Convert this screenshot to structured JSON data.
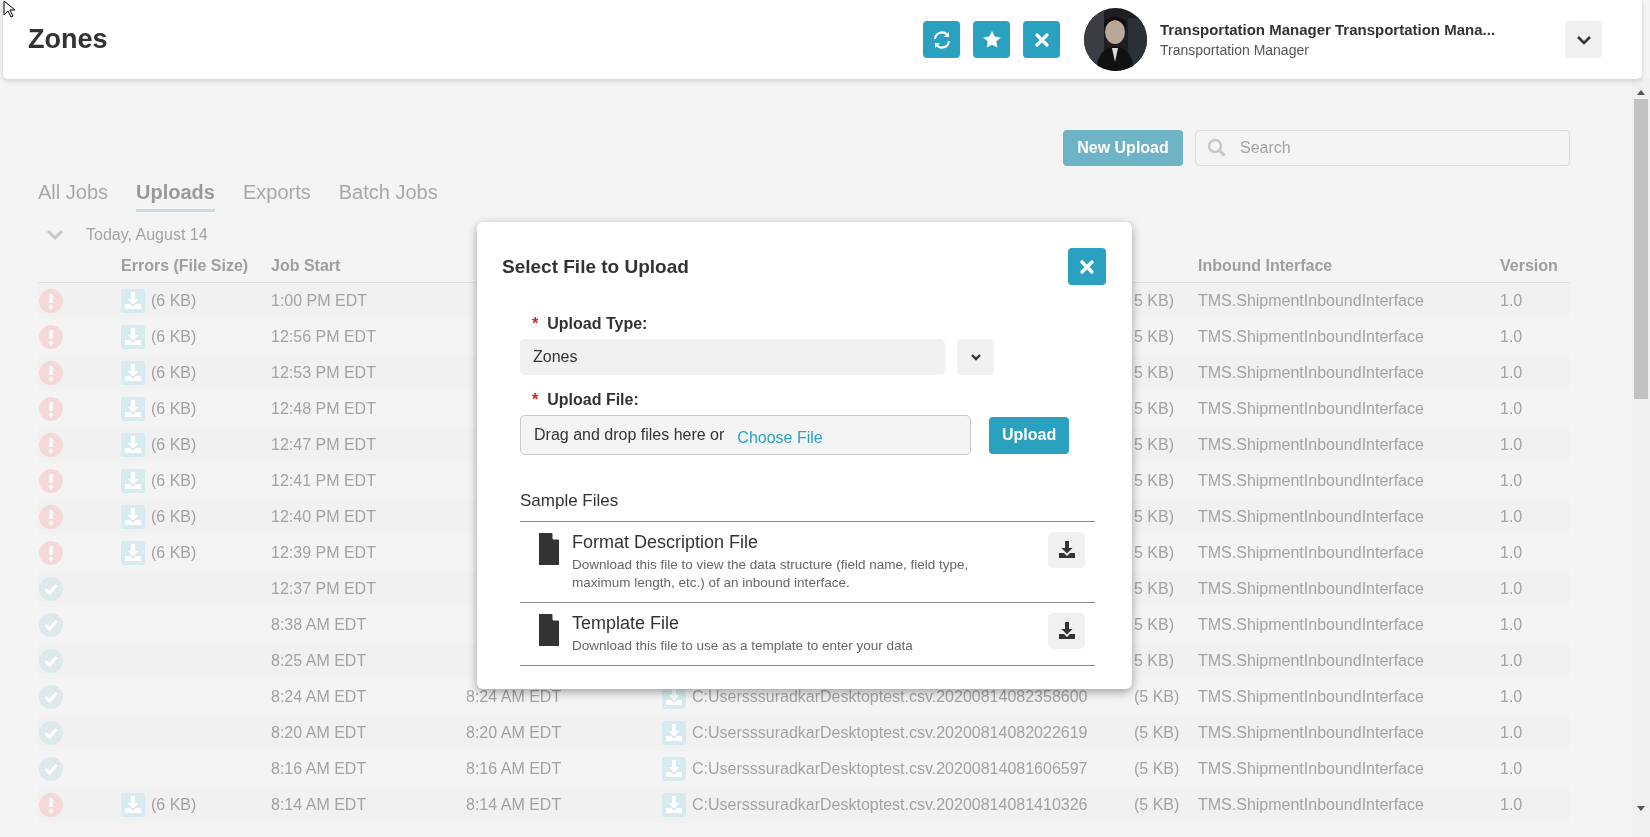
{
  "header": {
    "title": "Zones",
    "user": {
      "name": "Transportation Manager Transportation Mana...",
      "role": "Transportation Manager"
    }
  },
  "toolbar": {
    "new_upload": "New Upload",
    "search": {
      "placeholder": "Search"
    }
  },
  "tabs": [
    {
      "label": "All Jobs",
      "selected": false
    },
    {
      "label": "Uploads",
      "selected": true
    },
    {
      "label": "Exports",
      "selected": false
    },
    {
      "label": "Batch Jobs",
      "selected": false
    }
  ],
  "group": {
    "label": "Today, August 14",
    "expanded": true
  },
  "table": {
    "columns": [
      "Errors (File Size)",
      "Job Start",
      "Inbound Interface",
      "Version"
    ],
    "rows": [
      {
        "kind": "error",
        "error_size": "(6 KB)",
        "job_start": "1:00 PM EDT",
        "file_size": "5 KB)",
        "interface": "TMS.ShipmentInboundInterface",
        "version": "1.0"
      },
      {
        "kind": "error",
        "error_size": "(6 KB)",
        "job_start": "12:56 PM EDT",
        "file_size": "5 KB)",
        "interface": "TMS.ShipmentInboundInterface",
        "version": "1.0"
      },
      {
        "kind": "error",
        "error_size": "(6 KB)",
        "job_start": "12:53 PM EDT",
        "file_size": "5 KB)",
        "interface": "TMS.ShipmentInboundInterface",
        "version": "1.0"
      },
      {
        "kind": "error",
        "error_size": "(6 KB)",
        "job_start": "12:48 PM EDT",
        "file_size": "5 KB)",
        "interface": "TMS.ShipmentInboundInterface",
        "version": "1.0"
      },
      {
        "kind": "error",
        "error_size": "(6 KB)",
        "job_start": "12:47 PM EDT",
        "file_size": "5 KB)",
        "interface": "TMS.ShipmentInboundInterface",
        "version": "1.0"
      },
      {
        "kind": "error",
        "error_size": "(6 KB)",
        "job_start": "12:41 PM EDT",
        "file_size": "5 KB)",
        "interface": "TMS.ShipmentInboundInterface",
        "version": "1.0"
      },
      {
        "kind": "error",
        "error_size": "(6 KB)",
        "job_start": "12:40 PM EDT",
        "file_size": "5 KB)",
        "interface": "TMS.ShipmentInboundInterface",
        "version": "1.0"
      },
      {
        "kind": "error",
        "error_size": "(6 KB)",
        "job_start": "12:39 PM EDT",
        "file_size": "5 KB)",
        "interface": "TMS.ShipmentInboundInterface",
        "version": "1.0"
      },
      {
        "kind": "success",
        "job_start": "12:37 PM EDT",
        "file_size": "5 KB)",
        "interface": "TMS.ShipmentInboundInterface",
        "version": "1.0"
      },
      {
        "kind": "success",
        "job_start": "8:38 AM EDT",
        "file_size": "5 KB)",
        "interface": "TMS.ShipmentInboundInterface",
        "version": "1.0"
      },
      {
        "kind": "success",
        "job_start": "8:25 AM EDT",
        "file_size": "5 KB)",
        "interface": "TMS.ShipmentInboundInterface",
        "version": "1.0"
      },
      {
        "kind": "success",
        "job_start": "8:24 AM EDT",
        "job_end": "8:24 AM EDT",
        "file": "C:UsersssuradkarDesktoptest.csv.20200814082358600",
        "file_size": "(5 KB)",
        "interface": "TMS.ShipmentInboundInterface",
        "version": "1.0"
      },
      {
        "kind": "success",
        "job_start": "8:20 AM EDT",
        "job_end": "8:20 AM EDT",
        "file": "C:UsersssuradkarDesktoptest.csv.20200814082022619",
        "file_size": "(5 KB)",
        "interface": "TMS.ShipmentInboundInterface",
        "version": "1.0"
      },
      {
        "kind": "success",
        "job_start": "8:16 AM EDT",
        "job_end": "8:16 AM EDT",
        "file": "C:UsersssuradkarDesktoptest.csv.20200814081606597",
        "file_size": "(5 KB)",
        "interface": "TMS.ShipmentInboundInterface",
        "version": "1.0"
      },
      {
        "kind": "error",
        "error_size": "(6 KB)",
        "job_start": "8:14 AM EDT",
        "job_end": "8:14 AM EDT",
        "file": "C:UsersssuradkarDesktoptest.csv.20200814081410326",
        "file_size": "(5 KB)",
        "interface": "TMS.ShipmentInboundInterface",
        "version": "1.0"
      }
    ]
  },
  "dialog": {
    "title": "Select File to Upload",
    "fields": [
      {
        "kind": "select",
        "required_mark": "*",
        "label": "Upload Type:",
        "value": "Zones"
      },
      {
        "kind": "file",
        "required_mark": "*",
        "label": "Upload File:",
        "prompt": "Drag and drop files here or",
        "link": "Choose File",
        "button": "Upload"
      }
    ],
    "sample_files": {
      "heading": "Sample Files",
      "items": [
        {
          "title": "Format Description File",
          "description": "Download this file to view the data structure (field name, field type, maximum length, etc.) of an inbound interface."
        },
        {
          "title": "Template File",
          "description": "Download this file to use as a template to enter your data"
        }
      ]
    }
  }
}
